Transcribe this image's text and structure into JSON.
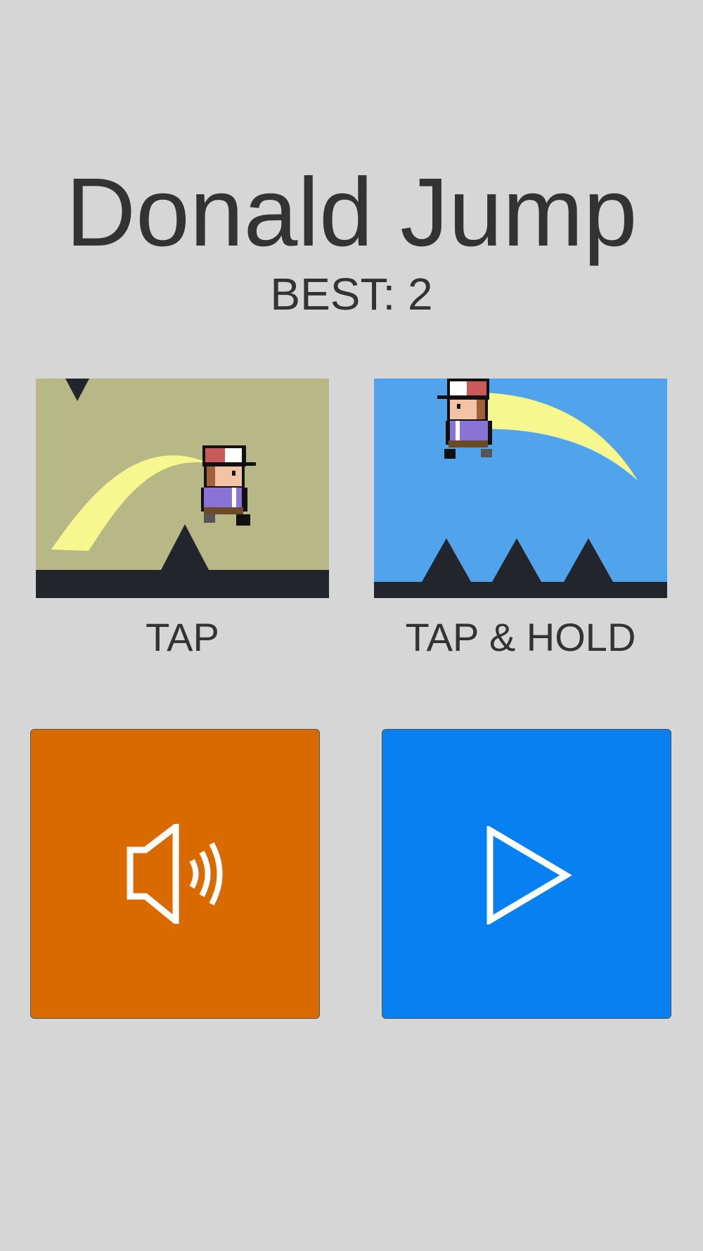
{
  "game": {
    "title": "Donald Jump",
    "best": "BEST: 2"
  },
  "modes": [
    {
      "label": "TAP",
      "background": "#b7b886"
    },
    {
      "label": "TAP & HOLD",
      "background": "#51a3ec"
    }
  ],
  "buttons": {
    "sound": {
      "icon": "speaker-icon",
      "color": "#d86a00"
    },
    "play": {
      "icon": "play-icon",
      "color": "#0780f2"
    }
  },
  "colors": {
    "background": "#d6d6d6",
    "text": "#333333",
    "ground": "#22252c",
    "trail": "#f7f78f"
  }
}
